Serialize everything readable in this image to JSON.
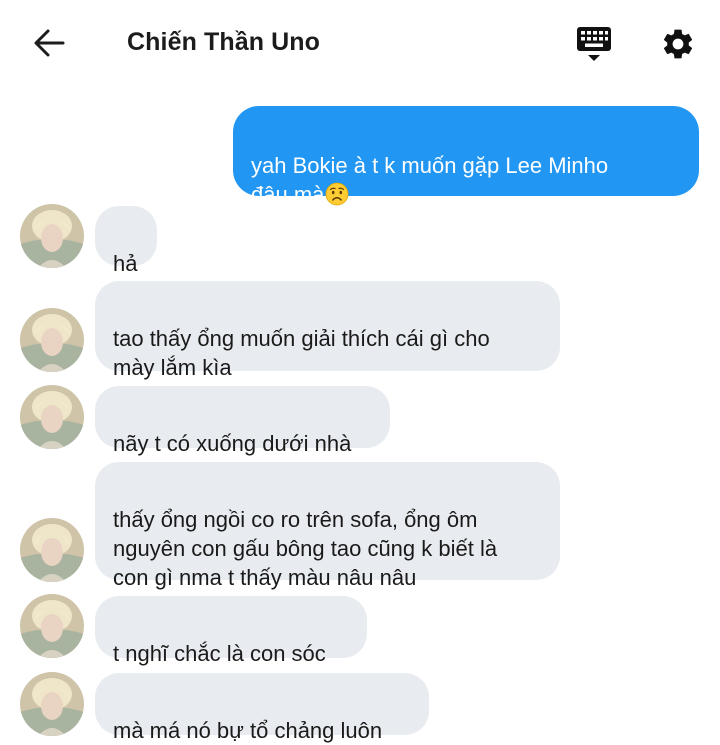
{
  "header": {
    "title": "Chiến Thần Uno"
  },
  "messages": {
    "outgoing": [
      {
        "text": "yah Bokie à t k muốn gặp Lee Minho\nđâu mà",
        "emoji": "worried-face-emoji"
      }
    ],
    "incoming": [
      {
        "text": "hả"
      },
      {
        "text": "tao thấy ổng muốn giải thích cái gì cho\nmày lắm kìa"
      },
      {
        "text": "nãy t có xuống dưới nhà"
      },
      {
        "text": "thấy ổng ngồi co ro trên sofa, ổng ôm\nnguyên con gấu bông tao cũng k biết là\ncon gì nma t thấy màu nâu nâu"
      },
      {
        "text": "t nghĩ chắc là con sóc"
      },
      {
        "text": "mà má nó bự tổ chảng luôn"
      }
    ]
  },
  "colors": {
    "outgoing_bubble": "#2196f3",
    "incoming_bubble": "#e8ecf0"
  },
  "icons": {
    "back": "arrow-left-icon",
    "keyboard": "keyboard-icon",
    "settings": "gear-icon"
  }
}
